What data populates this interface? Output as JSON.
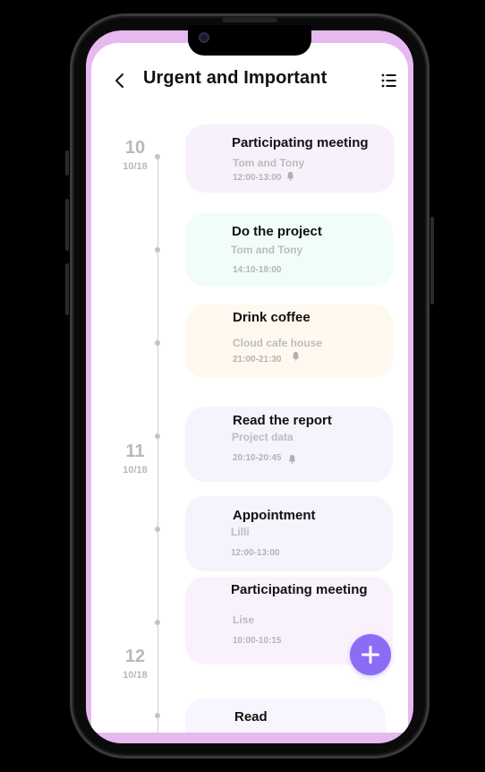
{
  "header": {
    "title": "Urgent and Important"
  },
  "days": [
    {
      "num": "10",
      "date": "10/18"
    },
    {
      "num": "11",
      "date": "10/18"
    },
    {
      "num": "12",
      "date": "10/18"
    }
  ],
  "tasks": [
    {
      "title": "Participating meeting",
      "subtitle": "Tom and Tony",
      "time": "12:00-13:00",
      "reminder": true,
      "color": "#f8f1fc"
    },
    {
      "title": "Do the project",
      "subtitle": "Tom and Tony",
      "time": "14:10-18:00",
      "reminder": false,
      "color": "#f1fdfb"
    },
    {
      "title": "Drink coffee",
      "subtitle": "Cloud cafe house",
      "time": "21:00-21:30",
      "reminder": true,
      "color": "#fff8ee"
    },
    {
      "title": "Read the report",
      "subtitle": "Project data",
      "time": "20:10-20:45",
      "reminder": true,
      "color": "#f6f3fd"
    },
    {
      "title": "Appointment",
      "subtitle": "Lilli",
      "time": "12:00-13:00",
      "reminder": false,
      "color": "#f6f3fd"
    },
    {
      "title": "Participating meeting",
      "subtitle": "Lise",
      "time": "10:00-10:15",
      "reminder": false,
      "color": "#f9f2fc"
    },
    {
      "title": "Read",
      "subtitle": "",
      "time": "",
      "reminder": false,
      "color": "#f7f5fd"
    }
  ],
  "icons": {
    "back": "chevron-left-icon",
    "menu": "list-icon",
    "reminder": "bell-icon",
    "add": "plus-icon"
  },
  "colors": {
    "accent": "#8c6cf5",
    "frame": "#e6b9f0",
    "muted_text": "#b9b9b9"
  }
}
